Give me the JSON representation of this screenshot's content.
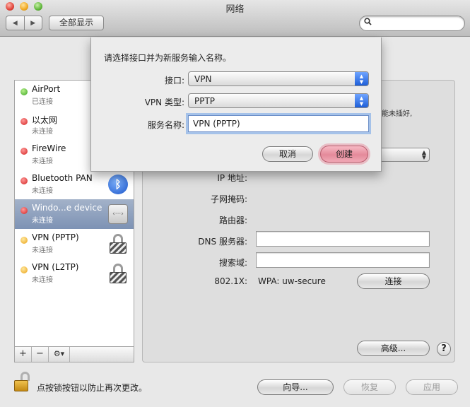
{
  "window": {
    "title": "网络",
    "show_all": "全部显示",
    "back_arrow": "◀",
    "forward_arrow": "▶",
    "search_icon": "🔍"
  },
  "services": [
    {
      "name": "AirPort",
      "status": "已连接",
      "dot": "green",
      "icon": "wifi-icon"
    },
    {
      "name": "以太网",
      "status": "未连接",
      "dot": "red",
      "icon": "ethernet-icon"
    },
    {
      "name": "FireWire",
      "status": "未连接",
      "dot": "red",
      "icon": "firewire-icon"
    },
    {
      "name": "Bluetooth PAN",
      "status": "未连接",
      "dot": "red",
      "icon": "bluetooth-icon"
    },
    {
      "name": "Windo...e device",
      "status": "未连接",
      "dot": "red",
      "icon": "ethernet-icon",
      "selected": true
    },
    {
      "name": "VPN (PPTP)",
      "status": "未连接",
      "dot": "yellow",
      "icon": "lock-icon"
    },
    {
      "name": "VPN (L2TP)",
      "status": "未连接",
      "dot": "yellow",
      "icon": "lock-icon"
    }
  ],
  "list_tools": {
    "add": "+",
    "remove": "−",
    "gear": "⚙▾"
  },
  "detail": {
    "ip_label": "IP 地址:",
    "subnet_label": "子网掩码:",
    "router_label": "路由器:",
    "dns_label": "DNS 服务器:",
    "search_domain_label": "搜索域:",
    "dot1x_label": "802.1X:",
    "dot1x_value": "WPA: uw-secure",
    "connect_button": "连接",
    "advanced_button": "高级...",
    "help_button": "?",
    "obscured_text": "能未插好,"
  },
  "footer": {
    "lock_text": "点按锁按钮以防止再次更改。",
    "assist_button": "向导...",
    "revert_button": "恢复",
    "apply_button": "应用"
  },
  "sheet": {
    "prompt": "请选择接口并为新服务输入名称。",
    "interface_label": "接口:",
    "interface_value": "VPN",
    "vpn_type_label": "VPN 类型:",
    "vpn_type_value": "PPTP",
    "service_name_label": "服务名称:",
    "service_name_value": "VPN (PPTP)",
    "cancel_button": "取消",
    "create_button": "创建"
  },
  "colors": {
    "accent_blue": "#1e5fd8",
    "default_button": "#e48a9a",
    "selection": "#7d92b4"
  }
}
